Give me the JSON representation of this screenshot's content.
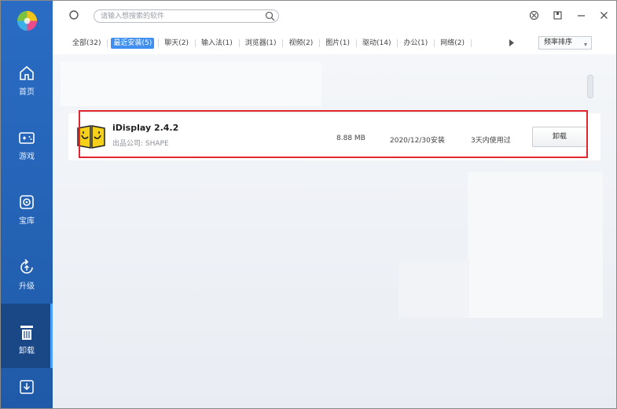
{
  "sidebar": {
    "items": [
      {
        "label": "首页",
        "icon": "home-icon"
      },
      {
        "label": "游戏",
        "icon": "gamepad-icon"
      },
      {
        "label": "宝库",
        "icon": "treasure-icon"
      },
      {
        "label": "升级",
        "icon": "upgrade-icon"
      },
      {
        "label": "卸载",
        "icon": "trash-icon",
        "active": true
      }
    ],
    "bottom_icon": "download-icon",
    "colors": {
      "background": "#2a6cc4",
      "active": "#1a4785"
    }
  },
  "header": {
    "search_placeholder": "请输入想搜索的软件",
    "icons": [
      "refresh-icon",
      "search-icon",
      "settings-icon",
      "skin-icon",
      "minimize-icon",
      "close-icon"
    ]
  },
  "tabs": [
    {
      "label": "全部(32)"
    },
    {
      "label": "最近安装(5)",
      "active": true
    },
    {
      "label": "聊天(2)"
    },
    {
      "label": "输入法(1)"
    },
    {
      "label": "浏览器(1)"
    },
    {
      "label": "视频(2)"
    },
    {
      "label": "图片(1)"
    },
    {
      "label": "驱动(14)"
    },
    {
      "label": "办公(1)"
    },
    {
      "label": "网络(2)"
    }
  ],
  "sort": {
    "label": "频率排序"
  },
  "apps": [
    {
      "name": "iDisplay 2.4.2",
      "publisher": "出品公司: SHAPE",
      "size": "8.88 MB",
      "installed": "2020/12/30安装",
      "usage": "3天内使用过",
      "action": "卸载",
      "icon": "idisplay-icon"
    }
  ],
  "accent_color": "#3f8ff0",
  "highlight_color": "#e0262f"
}
